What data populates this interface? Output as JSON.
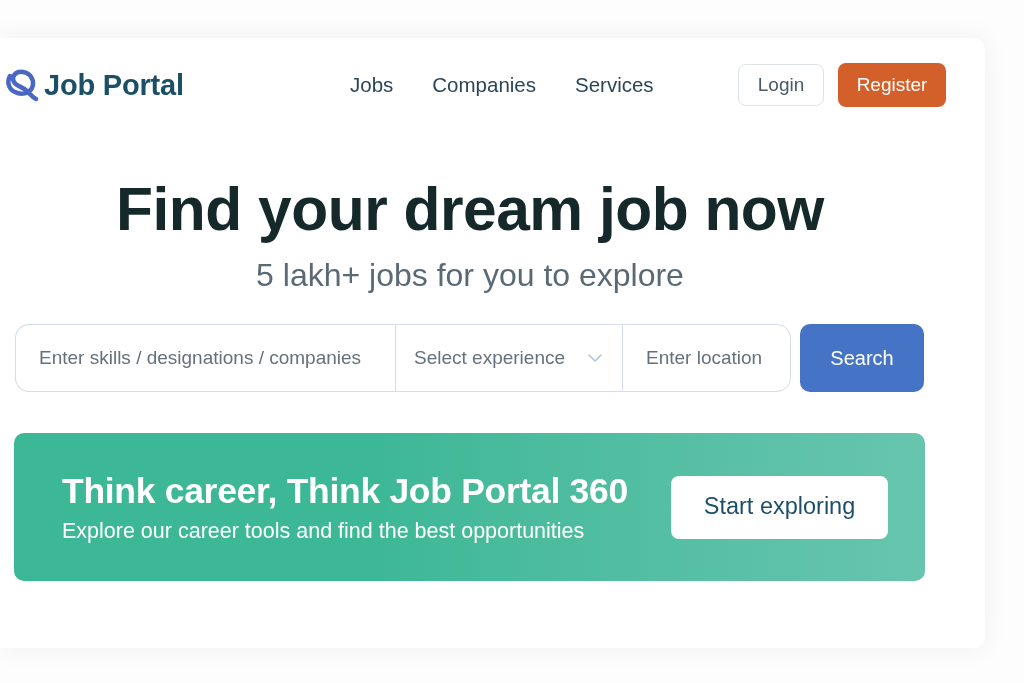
{
  "header": {
    "logo": {
      "text": "Job Portal"
    },
    "nav": [
      "Jobs",
      "Companies",
      "Services"
    ],
    "buttons": [
      {
        "label": "Login",
        "kind": "outline"
      },
      {
        "label": "Register",
        "kind": "primary"
      }
    ]
  },
  "hero": {
    "title": "Find your dream job now",
    "subtitle": "5 lakh+ jobs for you to explore"
  },
  "search": {
    "fields": [
      {
        "kind": "text",
        "placeholder": "Enter skills / designations / companies"
      },
      {
        "kind": "select",
        "placeholder": "Select experience"
      },
      {
        "kind": "text",
        "placeholder": "Enter location"
      }
    ],
    "button": "Search"
  },
  "banner": {
    "title": "Think career, Think Job Portal 360",
    "subtitle": "Explore our career tools and find the best opportunities",
    "button": "Start exploring"
  }
}
